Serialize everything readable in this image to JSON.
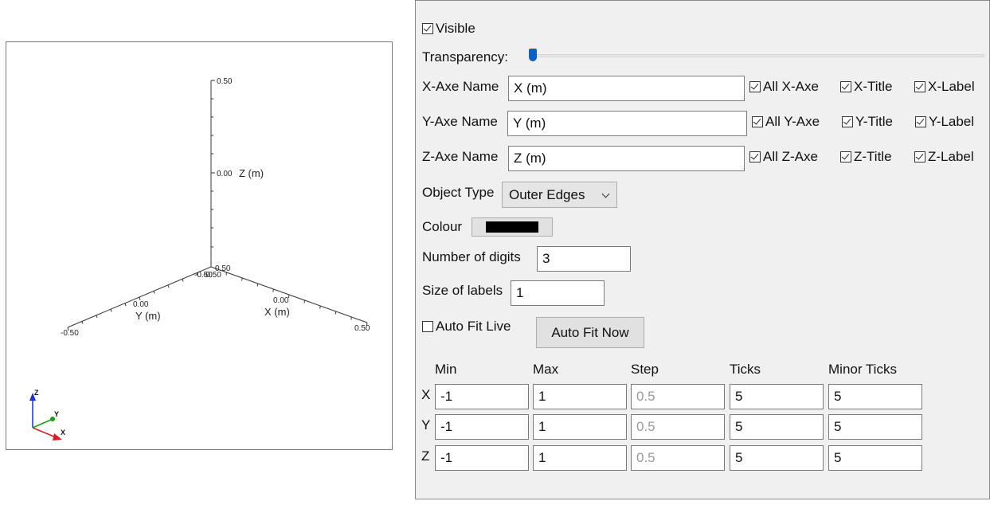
{
  "viewport": {
    "axes": {
      "z_top_tick": "0.50",
      "z_mid_tick": "0.00",
      "z_title": "Z (m)",
      "origin_tick_a": "-0.50",
      "origin_tick_b": "-0.50",
      "origin_tick_c": "0.50",
      "y_mid_tick": "0.00",
      "y_title": "Y (m)",
      "y_end_tick": "-0.50",
      "x_mid_tick": "0.00",
      "x_title": "X (m)",
      "x_end_tick": "0.50"
    },
    "triad": {
      "z": "Z",
      "y": "Y",
      "x": "X"
    }
  },
  "panel": {
    "visible": {
      "label": "Visible",
      "checked": true
    },
    "transparency": {
      "label": "Transparency:",
      "value_percent": 0
    },
    "axes_names": [
      {
        "label": "X-Axe Name",
        "value": "X (m)",
        "all": "All X-Axe",
        "title": "X-Title",
        "label_cb": "X-Label"
      },
      {
        "label": "Y-Axe Name",
        "value": "Y (m)",
        "all": "All Y-Axe",
        "title": "Y-Title",
        "label_cb": "Y-Label"
      },
      {
        "label": "Z-Axe Name",
        "value": "Z (m)",
        "all": "All Z-Axe",
        "title": "Z-Title",
        "label_cb": "Z-Label"
      }
    ],
    "object_type": {
      "label": "Object Type",
      "value": "Outer Edges"
    },
    "colour": {
      "label": "Colour",
      "swatch": "#000000"
    },
    "digits": {
      "label": "Number of digits",
      "value": "3"
    },
    "size_labels": {
      "label": "Size of labels",
      "value": "1"
    },
    "auto_fit_live": {
      "label": "Auto Fit Live",
      "checked": false
    },
    "auto_fit_now": {
      "label": "Auto Fit Now"
    },
    "range_table": {
      "headers": [
        "Min",
        "Max",
        "Step",
        "Ticks",
        "Minor Ticks"
      ],
      "rows": [
        {
          "axis": "X",
          "min": "-1",
          "max": "1",
          "step": "0.5",
          "ticks": "5",
          "minor": "5"
        },
        {
          "axis": "Y",
          "min": "-1",
          "max": "1",
          "step": "0.5",
          "ticks": "5",
          "minor": "5"
        },
        {
          "axis": "Z",
          "min": "-1",
          "max": "1",
          "step": "0.5",
          "ticks": "5",
          "minor": "5"
        }
      ]
    }
  },
  "colors": {
    "accent": "#0a5fc9",
    "triad_x": "#d42020",
    "triad_y": "#1a9e1a",
    "triad_z": "#1f2fd0"
  }
}
